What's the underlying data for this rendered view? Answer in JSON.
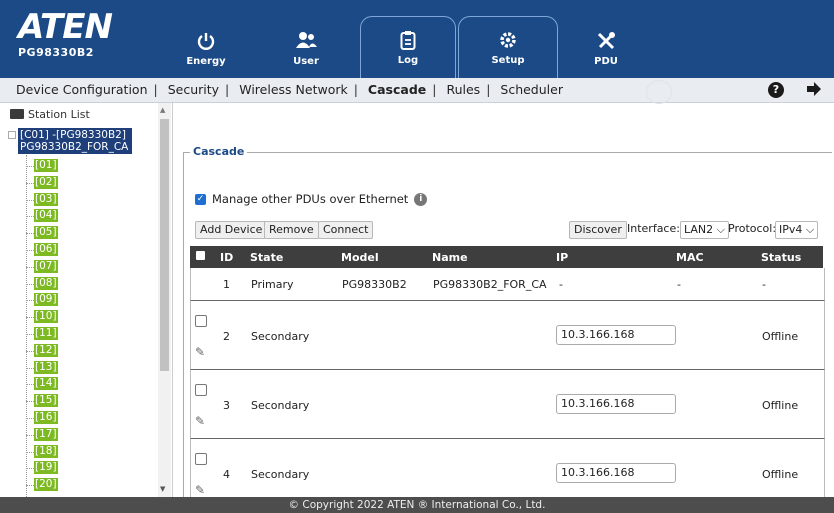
{
  "brand": {
    "logo": "ATEN",
    "model": "PG98330B2"
  },
  "nav": [
    {
      "label": "Energy",
      "icon": "power-icon"
    },
    {
      "label": "User",
      "icon": "users-icon"
    },
    {
      "label": "Log",
      "icon": "clipboard-icon"
    },
    {
      "label": "Setup",
      "icon": "gear-icon"
    },
    {
      "label": "PDU",
      "icon": "tools-icon"
    }
  ],
  "submenu": {
    "items": [
      "Device Configuration",
      "Security",
      "Wireless Network",
      "Cascade",
      "Rules",
      "Scheduler"
    ],
    "current": "Cascade"
  },
  "station": {
    "title": "Station List",
    "selected_line1": "[C01] -[PG98330B2]",
    "selected_line2": "PG98330B2_FOR_CA",
    "ports": [
      "[01]",
      "[02]",
      "[03]",
      "[04]",
      "[05]",
      "[06]",
      "[07]",
      "[08]",
      "[09]",
      "[10]",
      "[11]",
      "[12]",
      "[13]",
      "[14]",
      "[15]",
      "[16]",
      "[17]",
      "[18]",
      "[19]",
      "[20]"
    ]
  },
  "cascade": {
    "legend": "Cascade",
    "manage_label": "Manage other PDUs over Ethernet",
    "manage_checked": true,
    "buttons": {
      "add": "Add Device",
      "remove": "Remove",
      "connect": "Connect",
      "discover": "Discover"
    },
    "interface_label": "Interface:",
    "interface_value": "LAN2",
    "protocol_label": "Protocol:",
    "protocol_value": "IPv4",
    "columns": [
      "ID",
      "State",
      "Model",
      "Name",
      "IP",
      "MAC",
      "Status"
    ],
    "rows": [
      {
        "id": "1",
        "state": "Primary",
        "model": "PG98330B2",
        "name": "PG98330B2_FOR_CA",
        "ip": "-",
        "mac": "-",
        "status": "-"
      },
      {
        "id": "2",
        "state": "Secondary",
        "model": "",
        "name": "",
        "ip": "10.3.166.168",
        "mac": "",
        "status": "Offline"
      },
      {
        "id": "3",
        "state": "Secondary",
        "model": "",
        "name": "",
        "ip": "10.3.166.168",
        "mac": "",
        "status": "Offline"
      },
      {
        "id": "4",
        "state": "Secondary",
        "model": "",
        "name": "",
        "ip": "10.3.166.168",
        "mac": "",
        "status": "Offline"
      }
    ]
  },
  "footer": "© Copyright 2022 ATEN ® International Co., Ltd.",
  "colors": {
    "topbar": "#1b4a86",
    "port_tag": "#7dba21",
    "selected": "#1e3f7a"
  }
}
